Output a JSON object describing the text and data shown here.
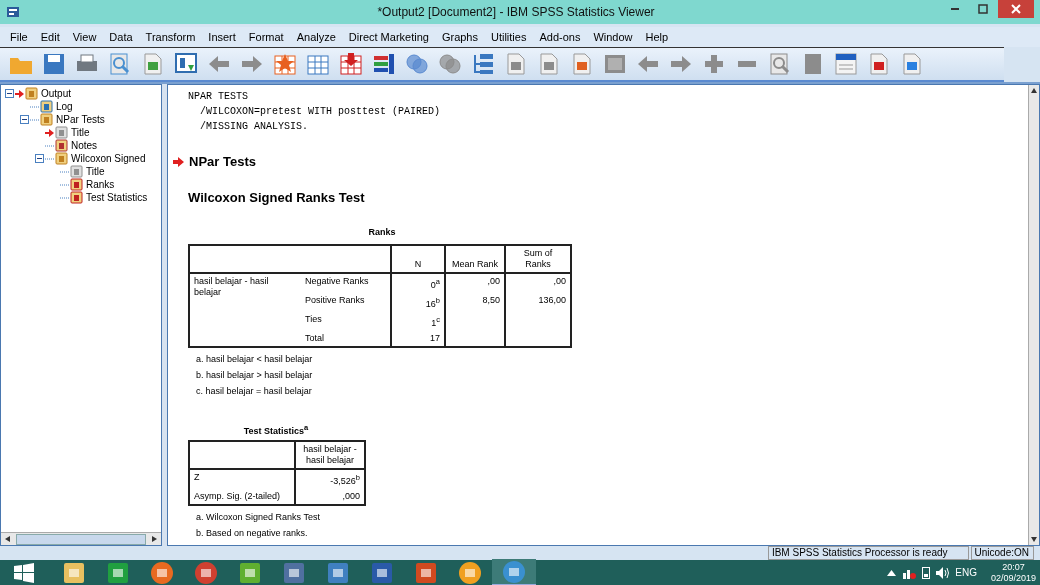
{
  "window": {
    "title": "*Output2 [Document2] - IBM SPSS Statistics Viewer"
  },
  "menu": [
    "File",
    "Edit",
    "View",
    "Data",
    "Transform",
    "Insert",
    "Format",
    "Analyze",
    "Direct Marketing",
    "Graphs",
    "Utilities",
    "Add-ons",
    "Window",
    "Help"
  ],
  "toolbar": [
    {
      "kind": "folder",
      "disabled": false
    },
    {
      "kind": "disk",
      "disabled": false
    },
    {
      "kind": "printer",
      "disabled": false
    },
    {
      "kind": "magnifier-page",
      "disabled": false
    },
    {
      "kind": "page-arrow",
      "disabled": false
    },
    {
      "kind": "window-arrow",
      "disabled": false
    },
    {
      "kind": "undo",
      "disabled": true
    },
    {
      "kind": "redo",
      "disabled": true
    },
    {
      "kind": "star-grid",
      "disabled": false
    },
    {
      "kind": "grid",
      "disabled": false
    },
    {
      "kind": "down-arrow-grid",
      "disabled": false
    },
    {
      "kind": "bars",
      "disabled": false
    },
    {
      "kind": "circles",
      "disabled": false
    },
    {
      "kind": "circles",
      "disabled": true
    },
    {
      "kind": "tree",
      "disabled": false
    },
    {
      "kind": "page",
      "disabled": true
    },
    {
      "kind": "page",
      "disabled": true
    },
    {
      "kind": "page-play",
      "disabled": false
    },
    {
      "kind": "square",
      "disabled": true
    },
    {
      "kind": "left-arrow",
      "disabled": true
    },
    {
      "kind": "right-arrow",
      "disabled": true
    },
    {
      "kind": "plus",
      "disabled": true
    },
    {
      "kind": "minus",
      "disabled": true
    },
    {
      "kind": "magnifier",
      "disabled": true
    },
    {
      "kind": "book",
      "disabled": true
    },
    {
      "kind": "heading",
      "disabled": false
    },
    {
      "kind": "page-flag",
      "disabled": false
    },
    {
      "kind": "page-export",
      "disabled": false
    }
  ],
  "tree": [
    {
      "label": "Output",
      "kind": "book",
      "current": true,
      "expanded": true,
      "children": [
        {
          "label": "Log",
          "kind": "log",
          "current": false
        },
        {
          "label": "NPar Tests",
          "kind": "book",
          "current": false,
          "expanded": true,
          "children": [
            {
              "label": "Title",
              "kind": "title",
              "current": true
            },
            {
              "label": "Notes",
              "kind": "notes",
              "current": false
            },
            {
              "label": "Wilcoxon Signed",
              "kind": "book",
              "current": false,
              "expanded": true,
              "children": [
                {
                  "label": "Title",
                  "kind": "title",
                  "current": false
                },
                {
                  "label": "Ranks",
                  "kind": "table",
                  "current": false
                },
                {
                  "label": "Test Statistics",
                  "kind": "table",
                  "current": false
                }
              ]
            }
          ]
        }
      ]
    }
  ],
  "syntax": [
    "NPAR TESTS",
    "  /WILCOXON=pretest WITH posttest (PAIRED)",
    "  /MISSING ANALYSIS."
  ],
  "heading": "NPar Tests",
  "subheading": "Wilcoxon Signed Ranks Test",
  "ranks": {
    "title": "Ranks",
    "columns": [
      "N",
      "Mean Rank",
      "Sum of Ranks"
    ],
    "group": "hasil belajar - hasil belajar",
    "rows": [
      {
        "label": "Negative Ranks",
        "n": "0$^{a}$",
        "mean": ",00",
        "sum": ",00"
      },
      {
        "label": "Positive Ranks",
        "n": "16$^{b}$",
        "mean": "8,50",
        "sum": "136,00"
      },
      {
        "label": "Ties",
        "n": "1$^{c}$"
      },
      {
        "label": "Total",
        "n": "17"
      }
    ],
    "footnotes": [
      "a. hasil belajar < hasil belajar",
      "b. hasil belajar > hasil belajar",
      "c. hasil belajar = hasil belajar"
    ]
  },
  "test_statistics": {
    "title": "Test Statistics$^{a}$",
    "column": "hasil belajar - hasil belajar",
    "rows": [
      {
        "label": "Z",
        "value": "-3,526$^{b}$"
      },
      {
        "label": "Asymp. Sig. (2-tailed)",
        "value": ",000"
      }
    ],
    "footnotes": [
      "a. Wilcoxon Signed Ranks Test",
      "b. Based on negative ranks."
    ]
  },
  "status_bar": {
    "message": "IBM SPSS Statistics Processor is ready",
    "encoding": "Unicode:ON"
  },
  "taskbar": {
    "apps": [
      {
        "kind": "folder",
        "selected": false
      },
      {
        "kind": "store",
        "selected": false
      },
      {
        "kind": "firefox",
        "selected": false
      },
      {
        "kind": "chrome",
        "selected": false
      },
      {
        "kind": "leaf",
        "selected": false
      },
      {
        "kind": "calculator",
        "selected": false
      },
      {
        "kind": "computer",
        "selected": false
      },
      {
        "kind": "word",
        "selected": false
      },
      {
        "kind": "powerpoint",
        "selected": false
      },
      {
        "kind": "ball",
        "selected": false
      },
      {
        "kind": "sigma",
        "selected": true
      }
    ],
    "language": "ENG",
    "time": "20:07",
    "date": "02/09/2019"
  }
}
